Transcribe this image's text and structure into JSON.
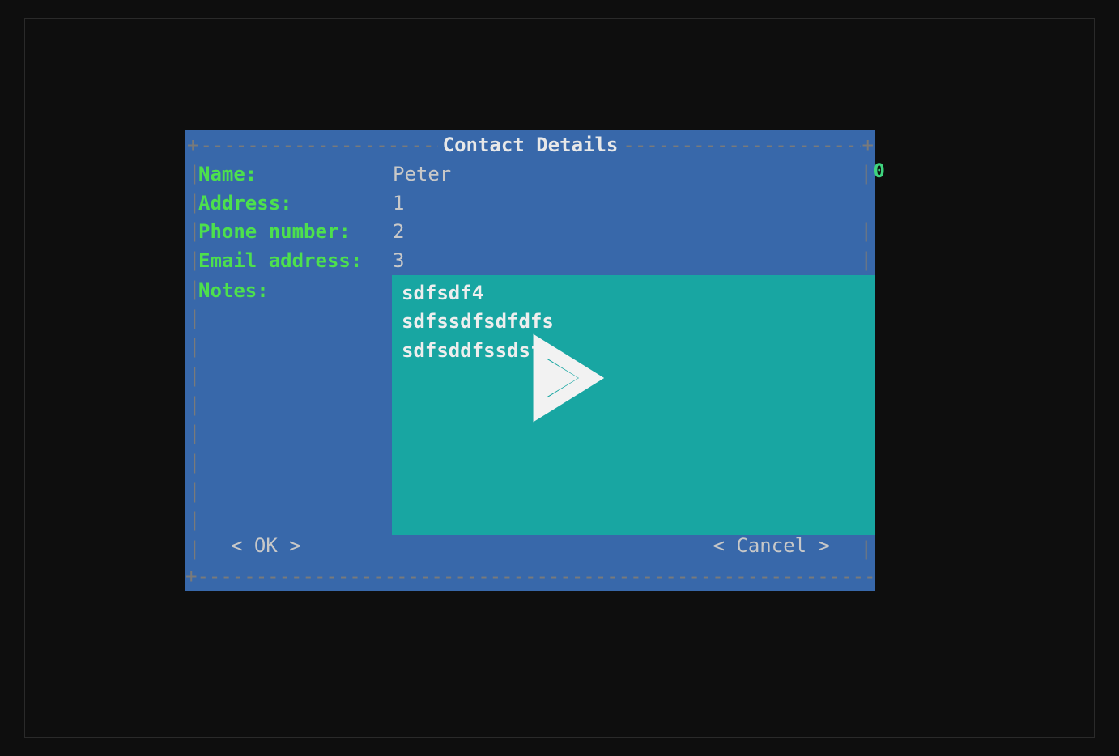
{
  "dialog": {
    "title": "Contact Details",
    "fields": {
      "name": {
        "label": "Name:",
        "value": "Peter"
      },
      "address": {
        "label": "Address:",
        "value": "1"
      },
      "phone": {
        "label": "Phone number:",
        "value": "2"
      },
      "email": {
        "label": "Email address:",
        "value": "3"
      },
      "notes": {
        "label": "Notes:",
        "value": "sdfsdf4\nsdfssdfsdfdfs\nsdfsddfssdsf"
      }
    },
    "scroll_indicator": "0",
    "buttons": {
      "ok": "< OK >",
      "cancel": "< Cancel >"
    }
  }
}
